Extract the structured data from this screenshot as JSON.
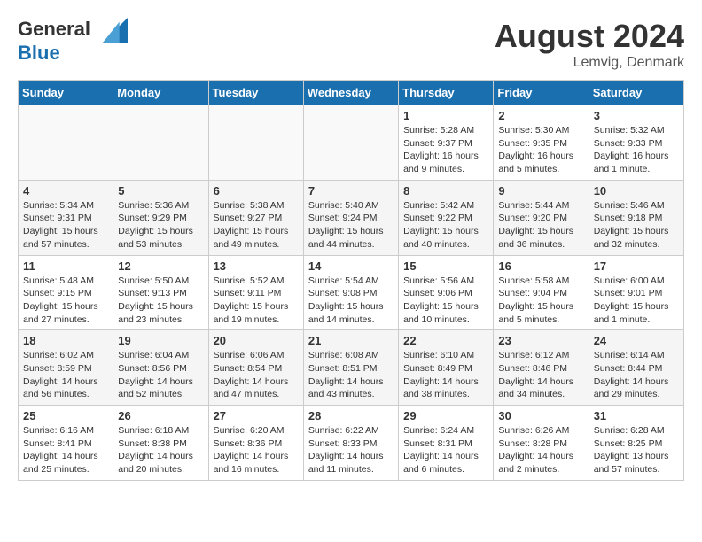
{
  "header": {
    "logo_line1": "General",
    "logo_line2": "Blue",
    "month": "August 2024",
    "location": "Lemvig, Denmark"
  },
  "weekdays": [
    "Sunday",
    "Monday",
    "Tuesday",
    "Wednesday",
    "Thursday",
    "Friday",
    "Saturday"
  ],
  "weeks": [
    [
      {
        "day": "",
        "info": ""
      },
      {
        "day": "",
        "info": ""
      },
      {
        "day": "",
        "info": ""
      },
      {
        "day": "",
        "info": ""
      },
      {
        "day": "1",
        "info": "Sunrise: 5:28 AM\nSunset: 9:37 PM\nDaylight: 16 hours\nand 9 minutes."
      },
      {
        "day": "2",
        "info": "Sunrise: 5:30 AM\nSunset: 9:35 PM\nDaylight: 16 hours\nand 5 minutes."
      },
      {
        "day": "3",
        "info": "Sunrise: 5:32 AM\nSunset: 9:33 PM\nDaylight: 16 hours\nand 1 minute."
      }
    ],
    [
      {
        "day": "4",
        "info": "Sunrise: 5:34 AM\nSunset: 9:31 PM\nDaylight: 15 hours\nand 57 minutes."
      },
      {
        "day": "5",
        "info": "Sunrise: 5:36 AM\nSunset: 9:29 PM\nDaylight: 15 hours\nand 53 minutes."
      },
      {
        "day": "6",
        "info": "Sunrise: 5:38 AM\nSunset: 9:27 PM\nDaylight: 15 hours\nand 49 minutes."
      },
      {
        "day": "7",
        "info": "Sunrise: 5:40 AM\nSunset: 9:24 PM\nDaylight: 15 hours\nand 44 minutes."
      },
      {
        "day": "8",
        "info": "Sunrise: 5:42 AM\nSunset: 9:22 PM\nDaylight: 15 hours\nand 40 minutes."
      },
      {
        "day": "9",
        "info": "Sunrise: 5:44 AM\nSunset: 9:20 PM\nDaylight: 15 hours\nand 36 minutes."
      },
      {
        "day": "10",
        "info": "Sunrise: 5:46 AM\nSunset: 9:18 PM\nDaylight: 15 hours\nand 32 minutes."
      }
    ],
    [
      {
        "day": "11",
        "info": "Sunrise: 5:48 AM\nSunset: 9:15 PM\nDaylight: 15 hours\nand 27 minutes."
      },
      {
        "day": "12",
        "info": "Sunrise: 5:50 AM\nSunset: 9:13 PM\nDaylight: 15 hours\nand 23 minutes."
      },
      {
        "day": "13",
        "info": "Sunrise: 5:52 AM\nSunset: 9:11 PM\nDaylight: 15 hours\nand 19 minutes."
      },
      {
        "day": "14",
        "info": "Sunrise: 5:54 AM\nSunset: 9:08 PM\nDaylight: 15 hours\nand 14 minutes."
      },
      {
        "day": "15",
        "info": "Sunrise: 5:56 AM\nSunset: 9:06 PM\nDaylight: 15 hours\nand 10 minutes."
      },
      {
        "day": "16",
        "info": "Sunrise: 5:58 AM\nSunset: 9:04 PM\nDaylight: 15 hours\nand 5 minutes."
      },
      {
        "day": "17",
        "info": "Sunrise: 6:00 AM\nSunset: 9:01 PM\nDaylight: 15 hours\nand 1 minute."
      }
    ],
    [
      {
        "day": "18",
        "info": "Sunrise: 6:02 AM\nSunset: 8:59 PM\nDaylight: 14 hours\nand 56 minutes."
      },
      {
        "day": "19",
        "info": "Sunrise: 6:04 AM\nSunset: 8:56 PM\nDaylight: 14 hours\nand 52 minutes."
      },
      {
        "day": "20",
        "info": "Sunrise: 6:06 AM\nSunset: 8:54 PM\nDaylight: 14 hours\nand 47 minutes."
      },
      {
        "day": "21",
        "info": "Sunrise: 6:08 AM\nSunset: 8:51 PM\nDaylight: 14 hours\nand 43 minutes."
      },
      {
        "day": "22",
        "info": "Sunrise: 6:10 AM\nSunset: 8:49 PM\nDaylight: 14 hours\nand 38 minutes."
      },
      {
        "day": "23",
        "info": "Sunrise: 6:12 AM\nSunset: 8:46 PM\nDaylight: 14 hours\nand 34 minutes."
      },
      {
        "day": "24",
        "info": "Sunrise: 6:14 AM\nSunset: 8:44 PM\nDaylight: 14 hours\nand 29 minutes."
      }
    ],
    [
      {
        "day": "25",
        "info": "Sunrise: 6:16 AM\nSunset: 8:41 PM\nDaylight: 14 hours\nand 25 minutes."
      },
      {
        "day": "26",
        "info": "Sunrise: 6:18 AM\nSunset: 8:38 PM\nDaylight: 14 hours\nand 20 minutes."
      },
      {
        "day": "27",
        "info": "Sunrise: 6:20 AM\nSunset: 8:36 PM\nDaylight: 14 hours\nand 16 minutes."
      },
      {
        "day": "28",
        "info": "Sunrise: 6:22 AM\nSunset: 8:33 PM\nDaylight: 14 hours\nand 11 minutes."
      },
      {
        "day": "29",
        "info": "Sunrise: 6:24 AM\nSunset: 8:31 PM\nDaylight: 14 hours\nand 6 minutes."
      },
      {
        "day": "30",
        "info": "Sunrise: 6:26 AM\nSunset: 8:28 PM\nDaylight: 14 hours\nand 2 minutes."
      },
      {
        "day": "31",
        "info": "Sunrise: 6:28 AM\nSunset: 8:25 PM\nDaylight: 13 hours\nand 57 minutes."
      }
    ]
  ]
}
